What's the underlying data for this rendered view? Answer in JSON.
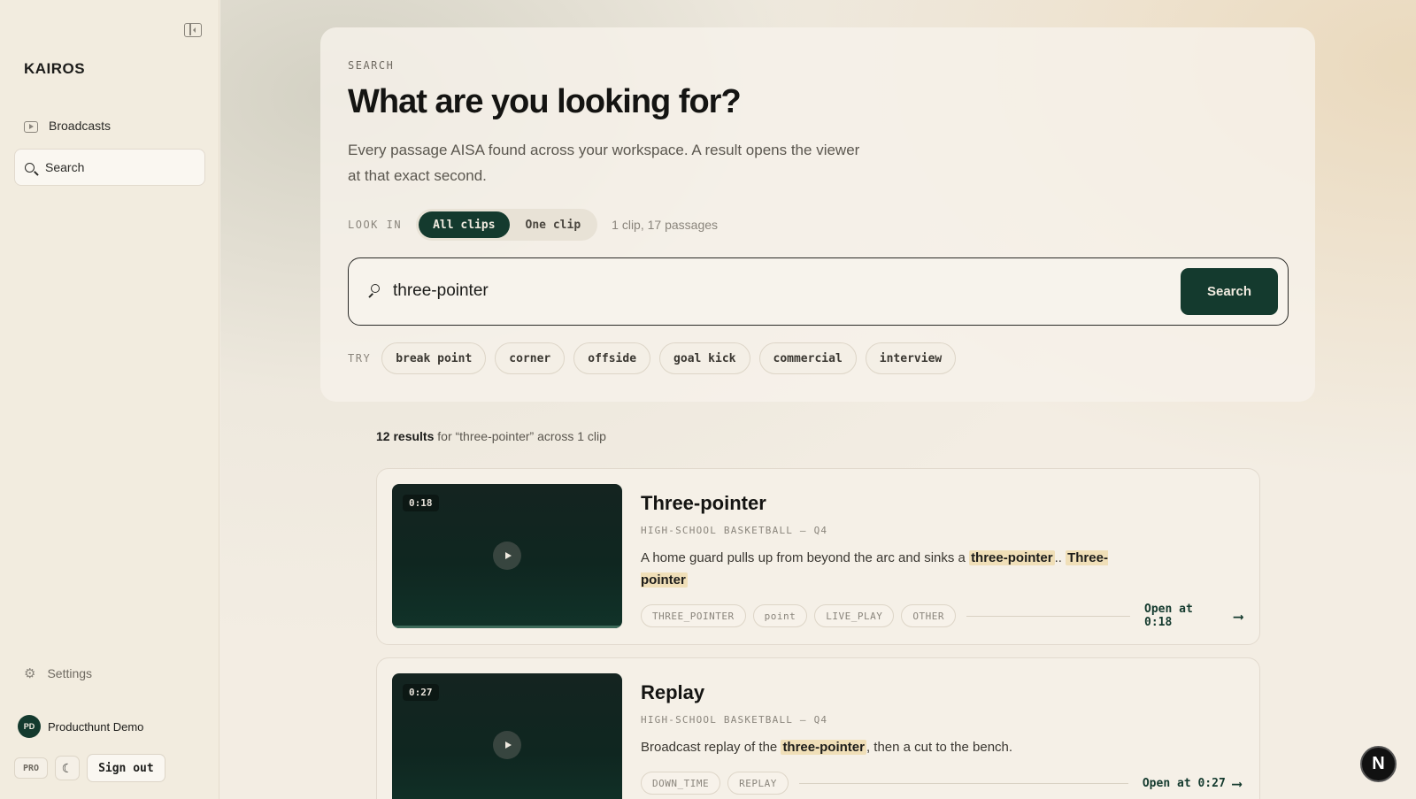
{
  "sidebar": {
    "brand": "KAIROS",
    "nav": [
      {
        "label": "Broadcasts",
        "active": false
      },
      {
        "label": "Search",
        "active": true
      }
    ],
    "settings_label": "Settings",
    "user": {
      "initials": "PD",
      "name": "Producthunt Demo"
    },
    "plan_badge": "PRO",
    "signout_label": "Sign out"
  },
  "search": {
    "eyebrow": "SEARCH",
    "headline": "What are you looking for?",
    "subtext": "Every passage AISA found across your workspace. A result opens the viewer at that exact second.",
    "look_in_label": "LOOK IN",
    "scope_options": [
      "All clips",
      "One clip"
    ],
    "scope_selected": "All clips",
    "count_text": "1 clip, 17 passages",
    "query": "three-pointer",
    "submit_label": "Search",
    "try_label": "TRY",
    "suggestions": [
      "break point",
      "corner",
      "offside",
      "goal kick",
      "commercial",
      "interview"
    ]
  },
  "results": {
    "count_label": "12 results",
    "summary_suffix": " for “three-pointer” across 1 clip",
    "items": [
      {
        "timecode": "0:18",
        "title": "Three-pointer",
        "meta": "HIGH-SCHOOL BASKETBALL — Q4",
        "text_before": "A home guard pulls up from beyond the arc and sinks a ",
        "highlight1": "three-pointer",
        "text_mid": ".. ",
        "highlight2": "Three-pointer",
        "text_after": "",
        "tags": [
          "THREE_POINTER",
          "point",
          "LIVE_PLAY",
          "OTHER"
        ],
        "open_label": "Open at 0:18"
      },
      {
        "timecode": "0:27",
        "title": "Replay",
        "meta": "HIGH-SCHOOL BASKETBALL — Q4",
        "text_before": "Broadcast replay of the ",
        "highlight1": "three-pointer",
        "text_mid": ", then a cut to the bench.",
        "tags": [
          "DOWN_TIME",
          "REPLAY"
        ],
        "open_label": "Open at 0:27"
      }
    ]
  },
  "fab_label": "N"
}
